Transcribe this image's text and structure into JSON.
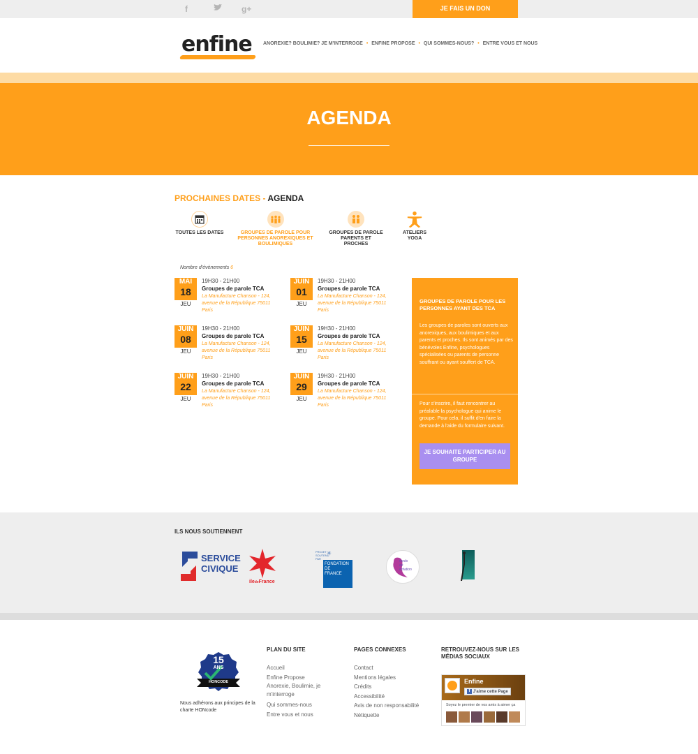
{
  "topbar": {
    "social_icons": [
      "facebook-icon",
      "twitter-icon",
      "google-plus-icon"
    ],
    "social_glyphs": [
      "f",
      "🐦",
      "g+"
    ],
    "donate_label": "JE FAIS UN DON"
  },
  "header": {
    "logo_text": "enfine",
    "nav": [
      "ANOREXIE? BOULIMIE? JE M'INTERROGE",
      "ENFINE PROPOSE",
      "QUI SOMMES-NOUS?",
      "ENTRE VOUS ET NOUS"
    ]
  },
  "hero": {
    "title": "AGENDA"
  },
  "section": {
    "title_a": "PROCHAINES DATES - ",
    "title_b": "AGENDA"
  },
  "categories": [
    {
      "label": "TOUTES LES DATES",
      "icon": "calendar-icon"
    },
    {
      "label": "GROUPES DE PAROLE POUR PERSONNES ANOREXIQUES ET BOULIMIQUES",
      "icon": "group-icon"
    },
    {
      "label": "GROUPES DE PAROLE PARENTS ET PROCHES",
      "icon": "parents-icon"
    },
    {
      "label": "ATELIERS YOGA",
      "icon": "yoga-icon"
    }
  ],
  "count": {
    "label": "Nombre d'évènements",
    "value": "6"
  },
  "events": [
    {
      "month": "MAI",
      "day": "18",
      "dow": "JEU",
      "time": "19H30 - 21H00",
      "title": "Groupes de parole TCA",
      "location": "La Manufacture Chanson - 124, avenue de la République 75011 Paris"
    },
    {
      "month": "JUIN",
      "day": "01",
      "dow": "JEU",
      "time": "19H30 - 21H00",
      "title": "Groupes de parole TCA",
      "location": "La Manufacture Chanson - 124, avenue de la République 75011 Paris"
    },
    {
      "month": "JUIN",
      "day": "08",
      "dow": "JEU",
      "time": "19H30 - 21H00",
      "title": "Groupes de parole TCA",
      "location": "La Manufacture Chanson - 124, avenue de la République 75011 Paris"
    },
    {
      "month": "JUIN",
      "day": "15",
      "dow": "JEU",
      "time": "19H30 - 21H00",
      "title": "Groupes de parole TCA",
      "location": "La Manufacture Chanson - 124, avenue de la République 75011 Paris"
    },
    {
      "month": "JUIN",
      "day": "22",
      "dow": "JEU",
      "time": "19H30 - 21H00",
      "title": "Groupes de parole TCA",
      "location": "La Manufacture Chanson - 124, avenue de la République 75011 Paris"
    },
    {
      "month": "JUIN",
      "day": "29",
      "dow": "JEU",
      "time": "19H30 - 21H00",
      "title": "Groupes de parole TCA",
      "location": "La Manufacture Chanson - 124, avenue de la République 75011 Paris"
    }
  ],
  "sidebar": {
    "heading": "GROUPES DE PAROLE POUR LES PERSONNES AYANT DES TCA",
    "p1": "Les groupes de paroles sont ouverts aux anorexiques, aux boulimiques et aux parents et proches. Ils sont animés par des bénévoles Enfine, psychologues spécialisées ou parents de personne souffrant ou ayant souffert de TCA.",
    "p2": "Pour s'inscrire, il faut rencontrer au préalable la psychologue qui anime le groupe. Pour cela, il suffit d'en faire la demande à l'aide du formulaire suivant.",
    "button": "JE SOUHAITE PARTICIPER AU GROUPE"
  },
  "sponsors": {
    "title": "ILS NOUS SOUTIENNENT",
    "service_civique": [
      "SERVICE",
      "CIVIQUE"
    ],
    "idf": [
      "ile",
      "de",
      "France"
    ],
    "fdf_small": "PROJET SOUTENU PAR",
    "fdf": [
      "FONDATION",
      "DE",
      "FRANCE"
    ],
    "fonds": [
      "fonds",
      "de",
      "dotation"
    ]
  },
  "footer": {
    "hon_number": "15",
    "hon_ans": "ANS",
    "hon_code": "HONCODE",
    "hon_text": "Nous adhérons aux principes de la charte HONcode",
    "plan_title": "PLAN DU SITE",
    "plan_links": [
      "Accueil",
      "Enfine Propose",
      "Anorexie, Boulimie, je m'interroge",
      "Qui sommes-nous",
      "Entre vous et nous"
    ],
    "pages_title": "PAGES CONNEXES",
    "pages_links": [
      "Contact",
      "Mentions légales",
      "Crédits",
      "Accessibilité",
      "Avis de non responsabilité",
      "Nétiquette"
    ],
    "social_title": "RETROUVEZ-NOUS SUR LES MÉDIAS SOCIAUX",
    "fb_name": "Enfine",
    "fb_like": "J'aime cette Page",
    "fb_text": "Soyez le premier de vos amis à aimer ça"
  },
  "colors": {
    "accent": "#ff9f1a",
    "button": "#a98ff0",
    "light_stripe": "#fddba4",
    "grey": "#eeeeee"
  }
}
